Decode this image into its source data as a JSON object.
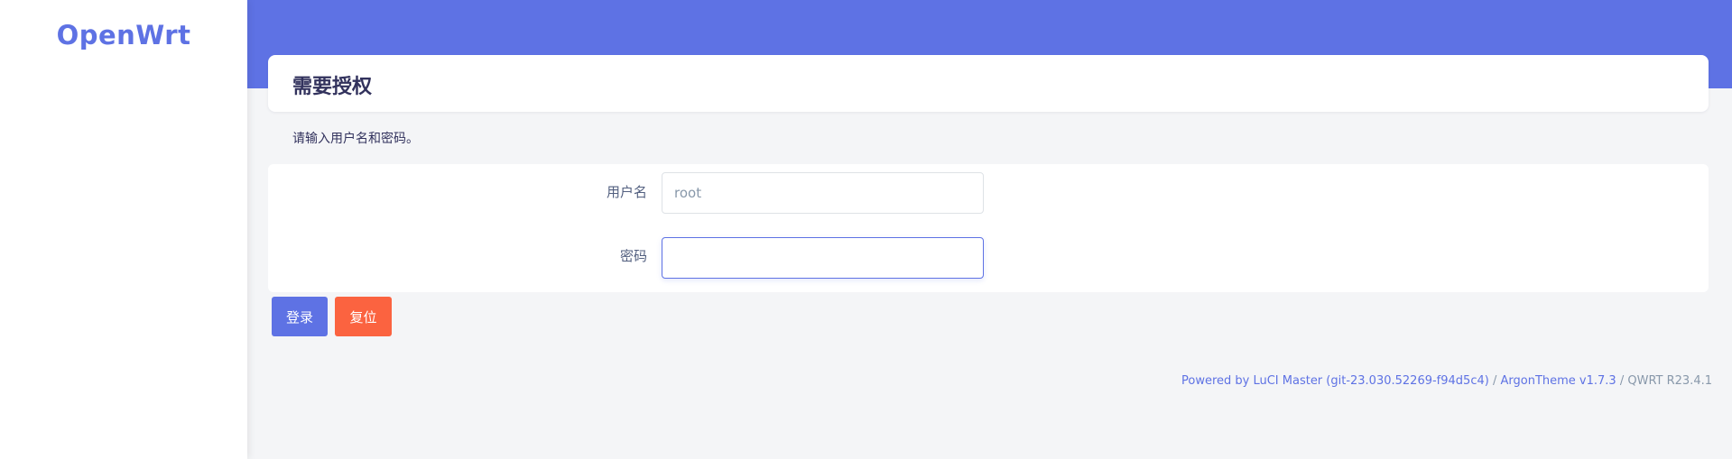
{
  "brand": {
    "logo_text": "OpenWrt",
    "accent_color": "#5e72e4",
    "danger_color": "#fb6340"
  },
  "auth": {
    "title": "需要授权",
    "description": "请输入用户名和密码。",
    "username_label": "用户名",
    "username_value": "root",
    "password_label": "密码",
    "password_value": "",
    "login_button": "登录",
    "reset_button": "复位"
  },
  "footer": {
    "luci_link": "Powered by LuCI Master (git-23.030.52269-f94d5c4)",
    "separator": "/",
    "theme_link": "ArgonTheme v1.7.3",
    "firmware": "QWRT R23.4.1"
  }
}
